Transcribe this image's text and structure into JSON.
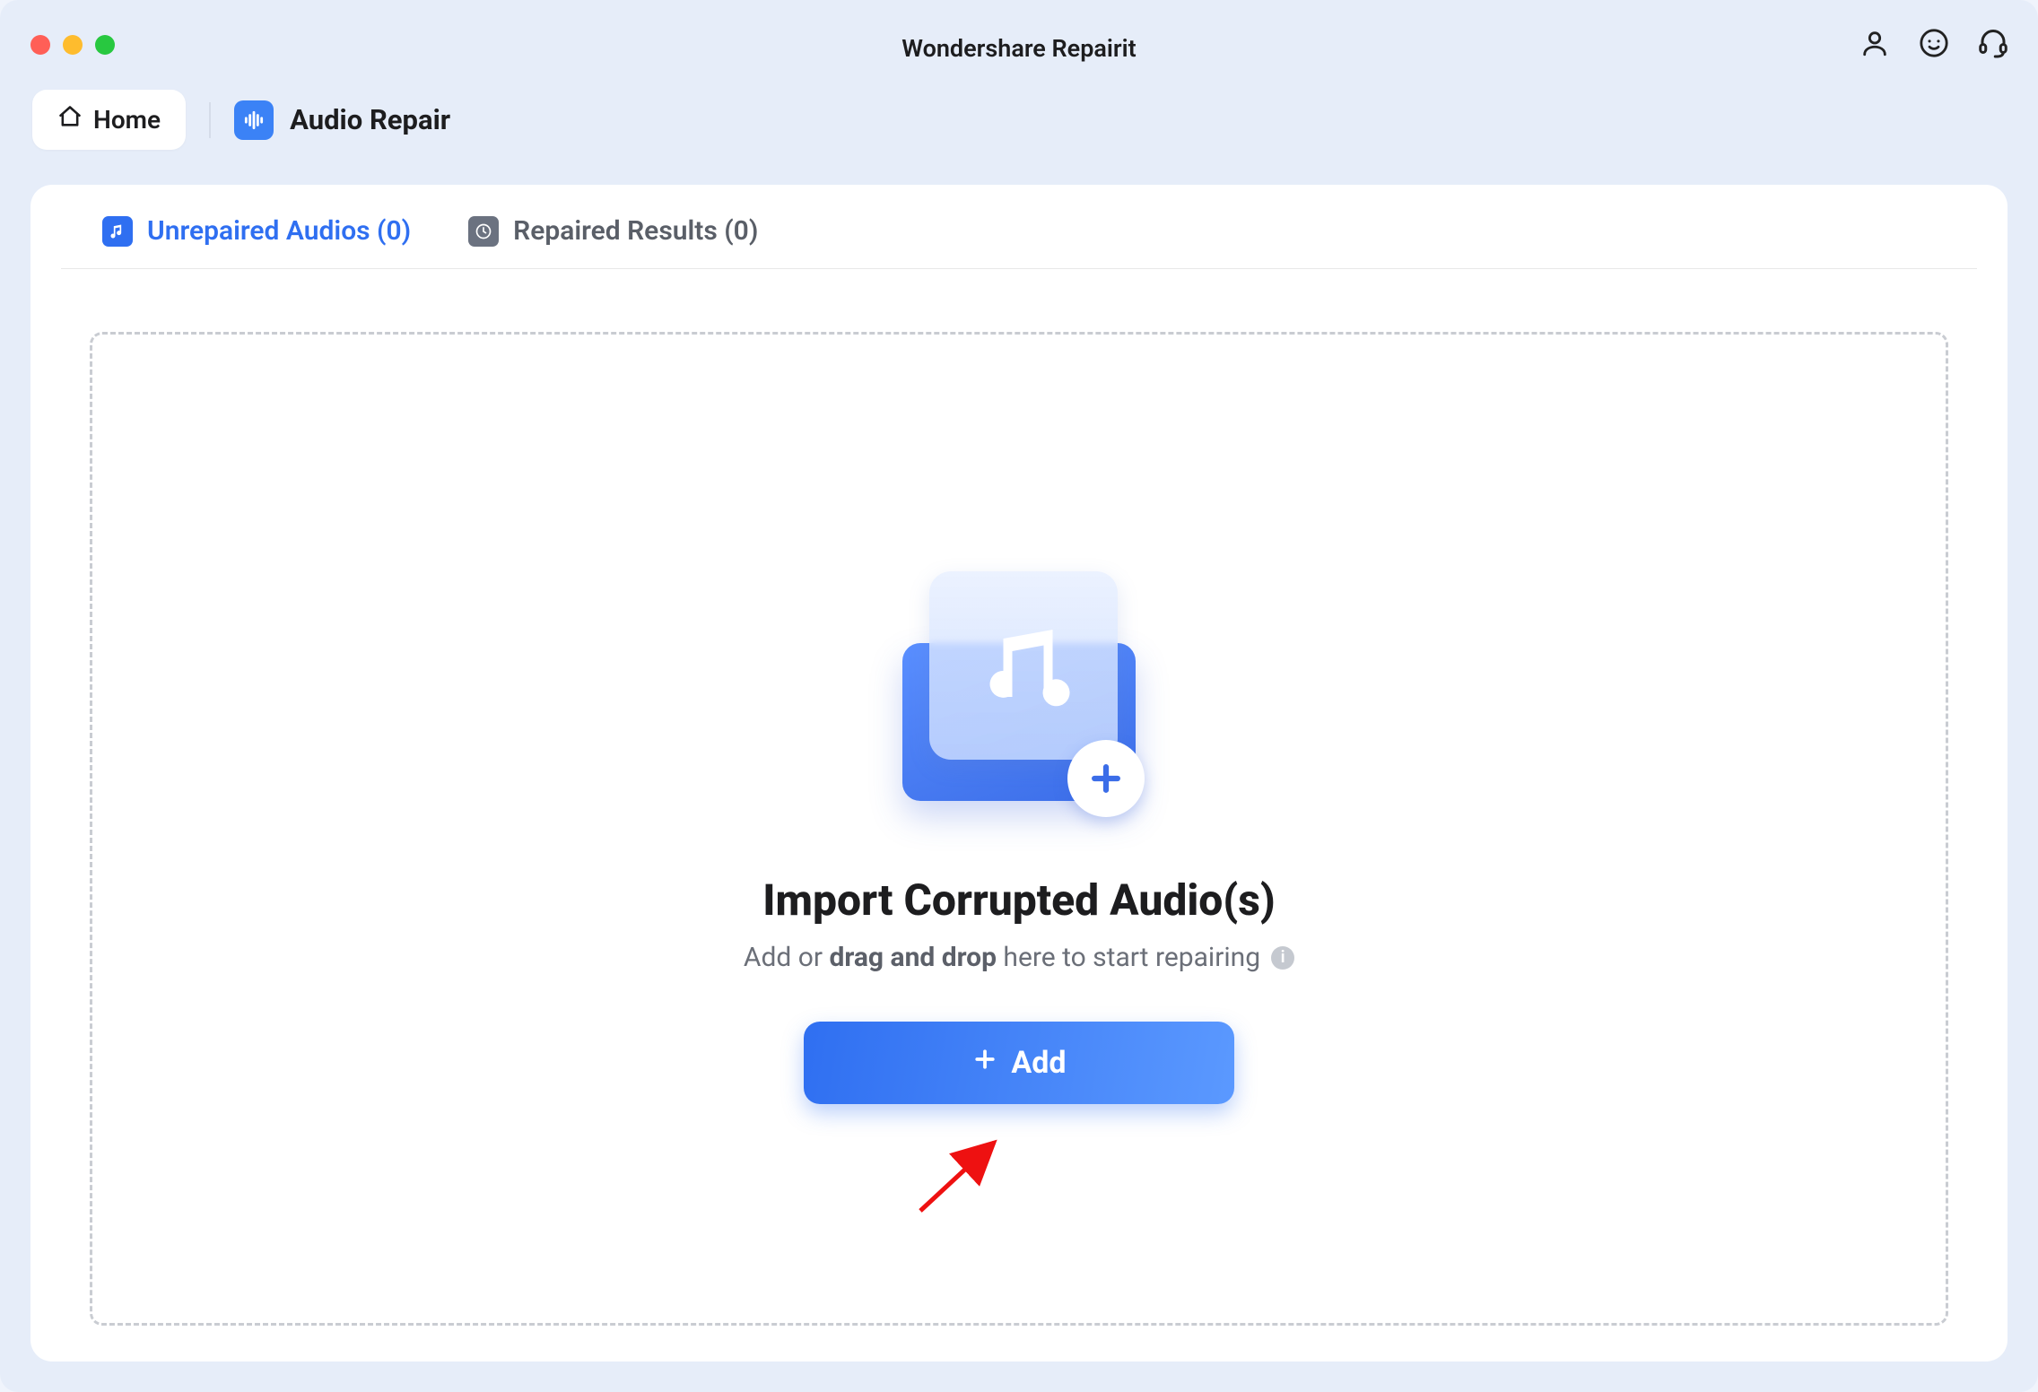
{
  "app": {
    "title": "Wondershare Repairit"
  },
  "nav": {
    "home_label": "Home",
    "mode_label": "Audio Repair"
  },
  "tabs": {
    "unrepaired": {
      "label": "Unrepaired Audios (0)"
    },
    "repaired": {
      "label": "Repaired Results (0)"
    }
  },
  "dropzone": {
    "title": "Import Corrupted Audio(s)",
    "sub_prefix": "Add or ",
    "sub_bold": "drag and drop",
    "sub_suffix": " here to start repairing",
    "add_label": "Add"
  },
  "colors": {
    "accent": "#2f6ff1",
    "bg": "#e6edf9",
    "panel": "#ffffff",
    "muted": "#6b6f78"
  }
}
